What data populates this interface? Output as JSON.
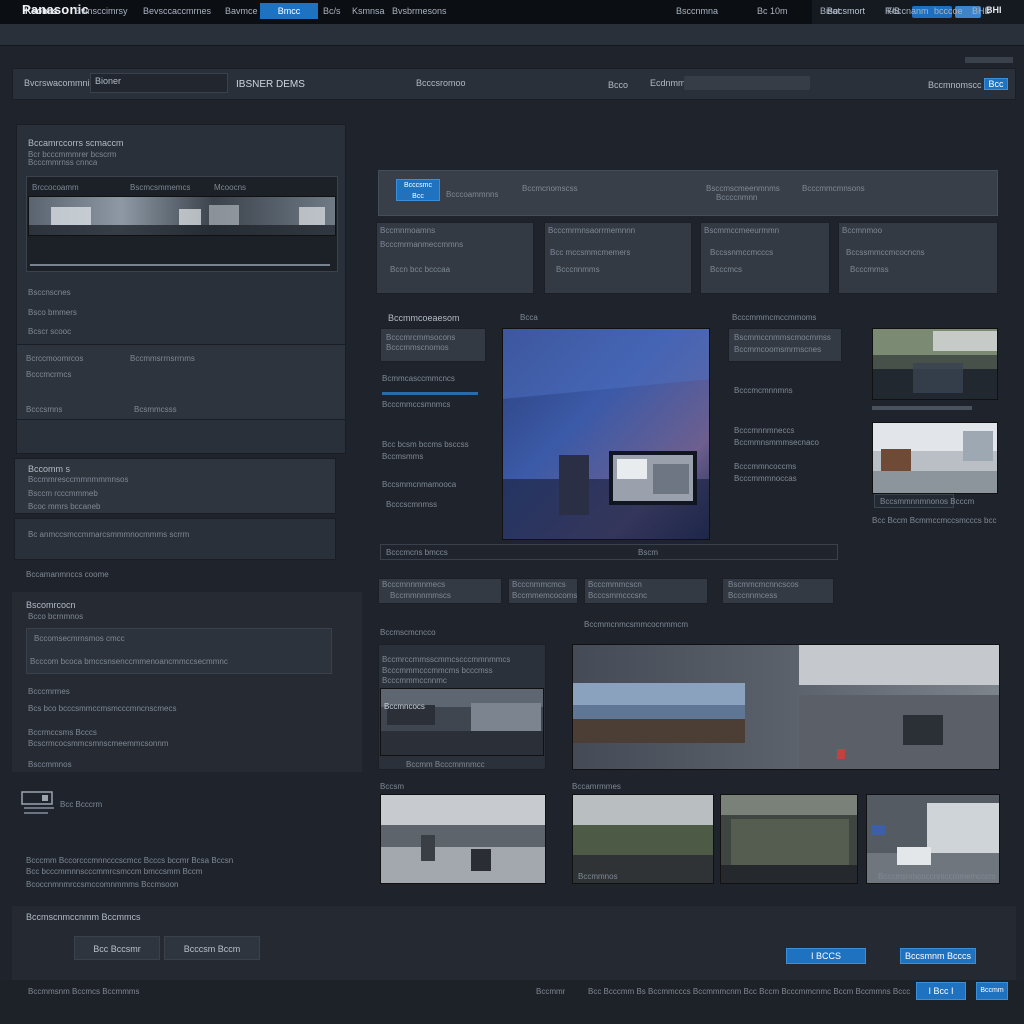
{
  "app": {
    "brand": "Panasonic"
  },
  "topbar": {
    "link_1": "Bocsmort",
    "link_2": "R/B",
    "user_label": "BHI"
  },
  "menu": {
    "items": [
      "Ksomis",
      "Ewnsccimrsy",
      "Bevsccaccmrnes",
      "Bavmce",
      "Bc/s",
      "Ksmnsa",
      "Bvsbrmesons",
      "Bsccnmna",
      "Bc 10m",
      "Bisat",
      "Fcccnanm",
      "bcccoe",
      "BHB"
    ],
    "active": "Bmcc"
  },
  "search_bar": {
    "label": "Bvcrswacommnis",
    "field_value": "Bioner",
    "center_text": "IBSNER DEMS",
    "status_1": "Bcccsromoo",
    "status_2": "Bcco",
    "status_3": "Ecdnmm",
    "right_text": "Bccmnomscc",
    "button": "Bcc"
  },
  "left_panel": {
    "title": "Bccamrccorrs scmaccm",
    "subtitle": "Bcr bcccmmmrer bcscrm",
    "row_1": "Bcccmmrnss cnnca",
    "timeline_labels": [
      "Brccocoamm",
      "Bscmcsmmemcs",
      "Mcoocns"
    ],
    "field_1": "Bsccnscnes",
    "field_2": "Bsco bmmers",
    "field_3": "Bcscr scooc",
    "row_a": "Bcrccmoomrcos",
    "row_a_val": "Bccmmsrrnsrrnms",
    "row_b": "Bcccmcrmcs",
    "row_c": "Bcccsmns",
    "row_c_val": "Bcsmmcsss"
  },
  "left_mid": {
    "title": "Bccomm s",
    "lines": [
      "Bccmmresccmmnmmmnsos",
      "Bsccm rcccmmmeb",
      "Bcoc mmrs bccaneb",
      "Bc anmccsmccmmarcsmmmnocmmms scrrm"
    ],
    "footer": "Bccamanmnccs coome"
  },
  "left_lower": {
    "title": "Bscomrcocn",
    "subtitle": "Bcco bcrnmnos",
    "items": [
      "Bccomsecmrnsmos cmcc",
      "Bcccom bcoca bmccsnsenccmmenoancmmccsecmmnc",
      "Bcccmrmes",
      "Bcs bco bcccsmmccmsmcccmncnscmecs",
      "Bccrmccsms Bcccs",
      "Bcscrmcocsmmcsmnscmeemmcsonnm"
    ],
    "footer": "Bsccmmnos"
  },
  "left_bottom": {
    "label": "Bcc Bcccrm",
    "line_1": "Bcccmm Bccorcccmnncccscmcc Bcccs bccmr Bcsa Bccsn",
    "line_2": "Bcc bcccmmnnscccmmrcsmccm bmccsmm Bccm",
    "line_3": "Bcoccnmnmrccsmccomnmmms Bccmsoon"
  },
  "content_header": {
    "badge_1": "Bcccsmc",
    "badge_2": "Bcc",
    "text_1": "Bcccoammnns",
    "text_2": "Bccmcnomscss",
    "text_3": "Bsccmscmeenmnms",
    "text_4": "Bccccnmnn",
    "text_5": "Bcccmmcmnsons"
  },
  "cards": [
    {
      "title": "Bccmnmoamns",
      "line_1": "Bcccmrmanmeccmmns",
      "line_2": "Bccn bcc bcccaa"
    },
    {
      "title": "Bcccmrmnsaorrmemnnn",
      "line_1": "Bcc mccsmmcmemers",
      "line_2": "Bcccnnmms"
    },
    {
      "title": "Bscmmccmeeurmmn",
      "line_1": "Bccssnmccmcccs",
      "line_2": "Bcccmcs"
    },
    {
      "title": "Bccmnmoo",
      "line_1": "Bccssmmccmcocncns",
      "line_2": "Bcccmmss"
    }
  ],
  "viewer": {
    "title": "Bccmmcoeaesom",
    "label": "Bcca",
    "list": [
      "Bcccmrcmmsocons",
      "Bcccmmscnomos",
      "Bcmmcasccmmcncs",
      "Bcccmmccsmnmcs",
      "Bcc bcsm bccms bsccss",
      "Bccmsmms",
      "Bccsmmcnmamooca",
      "Bcccscmnmss"
    ],
    "caption": "Bcccmcns bmccs",
    "caption_right": "Bscm",
    "right_list": [
      "Bcccmmmcmccmmoms",
      "Bscmmccnmmscmocmmss",
      "Bccmmcoomsmrmscnes",
      "Bcccmcmnnmns",
      "Bcccmnnmneccs",
      "Bccmmnsmmmsecnaco",
      "Bcccmmncoccms",
      "Bcccmmmnoccas"
    ],
    "thumb_caption": "Bccsmmnnmnonos Bcccm",
    "thumb_footer": "Bcc Bccm Bcmmccmccsmcccs bcc"
  },
  "strip": {
    "items": [
      "Bcccmnnmnmecs",
      "Bcccnmmcmcs",
      "Bcccmmmcscn",
      "Bscmmcmcnncscos"
    ],
    "subs": [
      "Bccmmnnmmscs",
      "Bccmmemcocoms",
      "Bcccsmmcccsnc",
      "Bcccnnmcess"
    ]
  },
  "gallery": {
    "title_left": "Bccmscmcncco",
    "title_right": "Bccmmcnmcsmmcocnmmcm",
    "left_lines": [
      "Bccmrccmmsscmmcscccmmnmmcs",
      "Bcccmmmcccmmcms bcccmss",
      "Bcccmmmccnnmc"
    ],
    "left_thumb_label": "Bccmncocs",
    "left_thumb_footer": "Bccmm Bcccmmnmcc",
    "row2_title_left": "Bccsm",
    "row2_title_right": "Bccamrmmes",
    "thumb_footers": [
      "Bccmmnos",
      "Bcccmsnmcoccnmccmmemcccrs"
    ]
  },
  "bottom": {
    "title": "Bccmscnmccnmm Bccmmcs",
    "button_1": "Bcc Bccsmr",
    "button_2": "Bcccsm Bccm",
    "primary_1": "I BCCS",
    "primary_2": "Bccsmnm Bcccs"
  },
  "footer": {
    "left": "Bccmmsnm Bccmcs Bccmmms",
    "mid_1": "Bccmmr",
    "mid_2": "Bcc Bcccmm Bs Bccmmcccs Bccmmmcnm Bcc Bccm Bcccmmcnmc Bccm Bccmmns Bcccmmcscccmmoncs Bcccms",
    "button_1": "I Bcc I",
    "button_2": "Bccmm"
  },
  "colors": {
    "accent": "#1f72c0",
    "background": "#1f242c",
    "panel": "#2c323b",
    "topbar": "#0b0e13"
  }
}
